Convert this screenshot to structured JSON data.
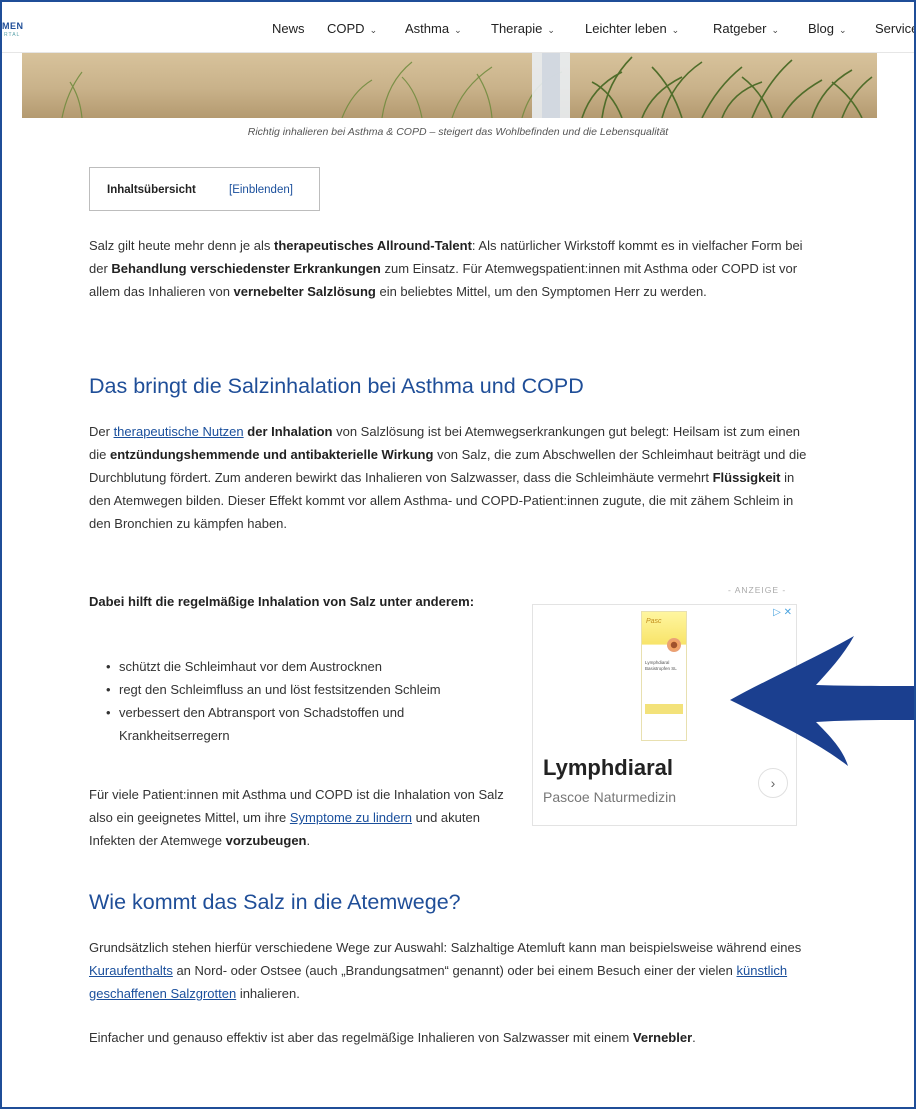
{
  "header": {
    "logo_text": "MEN",
    "logo_sub": "RTAL",
    "nav": [
      {
        "label": "News",
        "caret": ""
      },
      {
        "label": "COPD",
        "caret": "⌄"
      },
      {
        "label": "Asthma",
        "caret": "⌄"
      },
      {
        "label": "Therapie",
        "caret": "⌄"
      },
      {
        "label": "Leichter leben",
        "caret": "⌄"
      },
      {
        "label": "Ratgeber",
        "caret": "⌄"
      },
      {
        "label": "Blog",
        "caret": "⌄"
      },
      {
        "label": "Service",
        "caret": ""
      }
    ]
  },
  "hero": {
    "caption": "Richtig inhalieren bei Asthma & COPD – steigert das Wohlbefinden und die Lebensqualität"
  },
  "toc": {
    "title": "Inhaltsübersicht",
    "toggle": "[Einblenden]"
  },
  "intro": {
    "t1": "Salz gilt heute mehr denn je als ",
    "b1": "therapeutisches Allround-Talent",
    "t2": ": Als natürlicher Wirkstoff kommt es in vielfacher Form bei der ",
    "b2": "Behandlung verschiedenster Erkrankungen",
    "t3": " zum Einsatz. Für Atemwegspatient:innen mit Asthma oder COPD ist vor allem das Inhalieren von ",
    "b3": "vernebelter Salzlösung",
    "t4": " ein beliebtes Mittel, um den Symptomen Herr zu werden."
  },
  "section1": {
    "heading": "Das bringt die Salzinhalation bei Asthma und COPD",
    "t1": "Der ",
    "link1": "therapeutische Nutzen",
    "b1": " der Inhalation",
    "t2": " von Salzlösung ist bei Atemwegserkrankungen gut belegt: Heilsam ist zum einen die ",
    "b2": "entzündungshemmende und antibakterielle Wirkung",
    "t3": " von Salz, die zum Abschwellen der Schleimhaut beiträgt und die Durchblutung fördert. Zum anderen bewirkt das Inhalieren von Salzwasser, dass die Schleimhäute vermehrt ",
    "b3": "Flüssigkeit",
    "t4": " in den Atemwegen bilden. Dieser Effekt kommt vor allem Asthma- und COPD-Patient:innen zugute, die mit zähem Schleim in den Bronchien zu kämpfen haben.",
    "list_intro": "Dabei hilft die regelmäßige Inhalation von Salz unter anderem:",
    "bullets": [
      "schützt die Schleimhaut vor dem Austrocknen",
      "regt den Schleimfluss an und löst festsitzenden Schleim",
      "verbessert den Abtransport von Schadstoffen und Krankheitserregern"
    ],
    "after_t1": "Für viele Patient:innen mit Asthma und COPD ist die Inhalation von Salz also ein geeignetes Mittel, um ihre ",
    "after_link": "Symptome zu lindern",
    "after_t2": " und akuten Infekten der Atemwege ",
    "after_b": "vorzubeugen",
    "after_t3": "."
  },
  "section2": {
    "heading": "Wie kommt das Salz in die Atemwege?",
    "t1": "Grundsätzlich stehen hierfür verschiedene Wege zur Auswahl: Salzhaltige Atemluft kann man beispielsweise während eines ",
    "link1": "Kuraufenthalts",
    "t2": " an Nord- oder Ostsee (auch „Brandungsatmen“ genannt) oder bei einem Besuch einer der vielen ",
    "link2": "künstlich geschaffenen Salzgrotten",
    "t3": " inhalieren.",
    "p2_t1": "Einfacher und genauso effektiv ist aber das regelmäßige Inhalieren von Salzwasser mit einem ",
    "p2_b": "Vernebler",
    "p2_t2": "."
  },
  "ad": {
    "label": "- ANZEIGE -",
    "icons": "▷ ✕",
    "title": "Lymphdiaral",
    "subtitle": "Pascoe Naturmedizin",
    "next": "›",
    "box_brand": "Pasc",
    "box_name": "Lymphdiaral",
    "box_sub": "Basistropfen SL"
  },
  "colors": {
    "accent": "#1f4e98",
    "link": "#1a4f9c",
    "arrow": "#1b3f8f"
  }
}
